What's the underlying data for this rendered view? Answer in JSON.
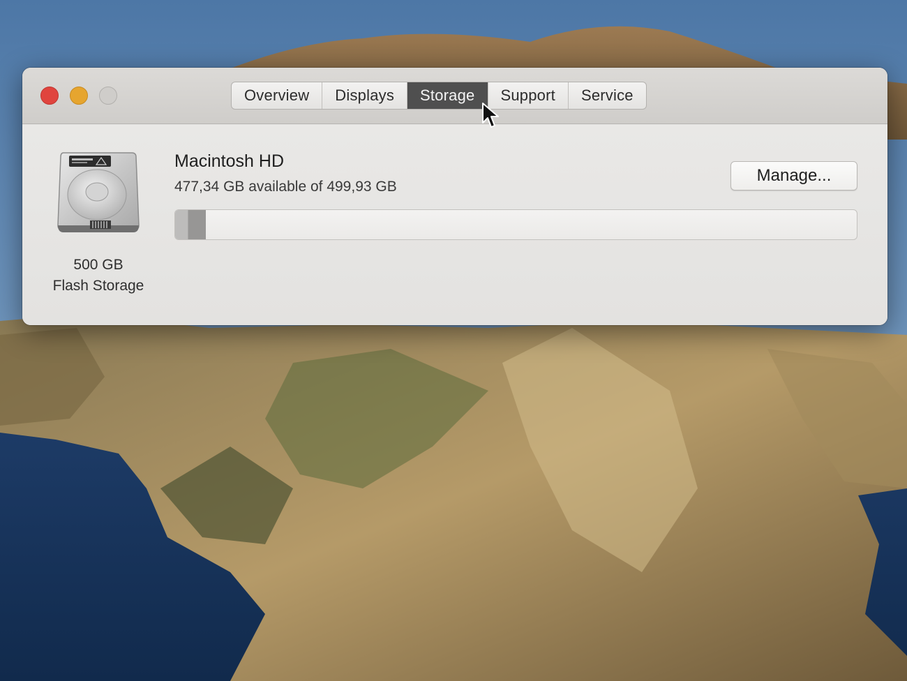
{
  "window": {
    "tabs": [
      {
        "label": "Overview",
        "active": false
      },
      {
        "label": "Displays",
        "active": false
      },
      {
        "label": "Storage",
        "active": true
      },
      {
        "label": "Support",
        "active": false
      },
      {
        "label": "Service",
        "active": false
      }
    ]
  },
  "storage": {
    "disk_caption_line1": "500 GB",
    "disk_caption_line2": "Flash Storage",
    "volume_name": "Macintosh HD",
    "availability_text": "477,34 GB available of 499,93 GB",
    "manage_label": "Manage...",
    "used_fraction": 0.045
  },
  "colors": {
    "close": "#e0443e",
    "minimize": "#e6a52f",
    "zoom_inactive": "#cfcdca",
    "active_tab": "#4f4f4f"
  },
  "icons": [
    "close-icon",
    "minimize-icon",
    "zoom-icon",
    "hard-drive-icon",
    "mouse-pointer-icon"
  ]
}
